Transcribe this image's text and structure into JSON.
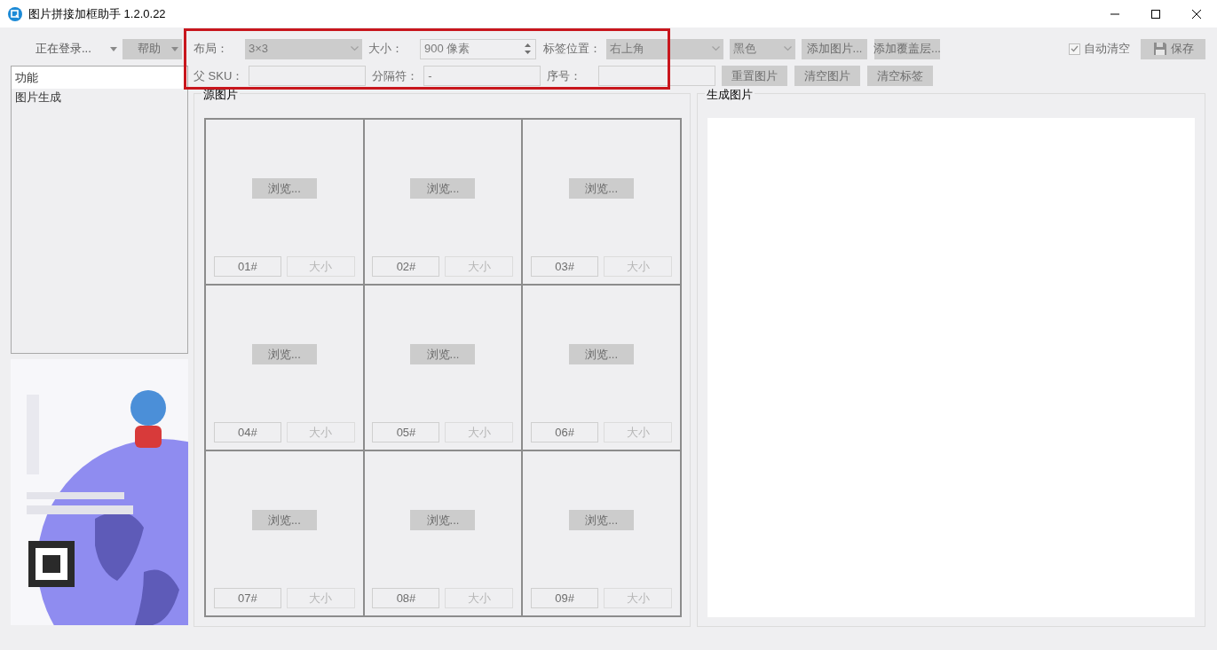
{
  "window": {
    "title": "图片拼接加框助手 1.2.0.22"
  },
  "account_menu": {
    "label": "正在登录..."
  },
  "help_menu": {
    "label": "帮助"
  },
  "toolbar_row1": [
    {
      "kind": "label",
      "text": "布局："
    },
    {
      "kind": "combo",
      "value": "3×3"
    },
    {
      "kind": "label",
      "text": "大小："
    },
    {
      "kind": "spin",
      "value": "900 像素"
    },
    {
      "kind": "label",
      "text": "标签位置："
    },
    {
      "kind": "combo",
      "value": "右上角"
    },
    {
      "kind": "short_combo",
      "value": "黑色"
    },
    {
      "kind": "button",
      "text": "添加图片..."
    },
    {
      "kind": "button",
      "text": "添加覆盖层..."
    }
  ],
  "toolbar_row2": [
    {
      "kind": "label",
      "text": "父 SKU："
    },
    {
      "kind": "input"
    },
    {
      "kind": "label",
      "text": "分隔符："
    },
    {
      "kind": "input",
      "value": "-"
    },
    {
      "kind": "label",
      "text": "序号："
    },
    {
      "kind": "input"
    },
    {
      "kind": "button",
      "text": "重置图片"
    },
    {
      "kind": "button",
      "text": "清空图片"
    },
    {
      "kind": "button",
      "text": "清空标签"
    }
  ],
  "auto_clear": {
    "label": "自动清空",
    "checked": true
  },
  "save_button": {
    "label": "保存"
  },
  "sidebar": {
    "header": "功能",
    "items": [
      "图片生成"
    ]
  },
  "source_group": {
    "title": "源图片",
    "cells": [
      {
        "browse": "浏览...",
        "tag": "01#",
        "size": "大小"
      },
      {
        "browse": "浏览...",
        "tag": "02#",
        "size": "大小"
      },
      {
        "browse": "浏览...",
        "tag": "03#",
        "size": "大小"
      },
      {
        "browse": "浏览...",
        "tag": "04#",
        "size": "大小"
      },
      {
        "browse": "浏览...",
        "tag": "05#",
        "size": "大小"
      },
      {
        "browse": "浏览...",
        "tag": "06#",
        "size": "大小"
      },
      {
        "browse": "浏览...",
        "tag": "07#",
        "size": "大小"
      },
      {
        "browse": "浏览...",
        "tag": "08#",
        "size": "大小"
      },
      {
        "browse": "浏览...",
        "tag": "09#",
        "size": "大小"
      }
    ]
  },
  "result_group": {
    "title": "生成图片"
  }
}
